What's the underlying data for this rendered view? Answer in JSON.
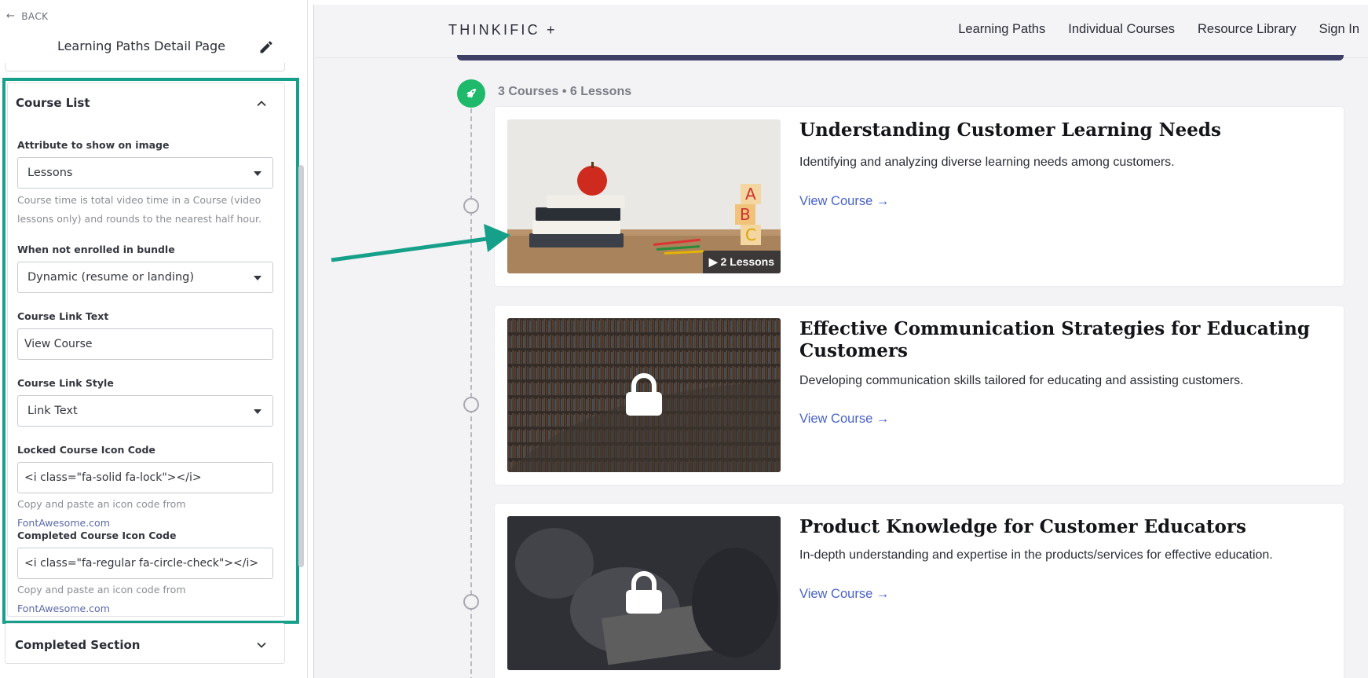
{
  "editor": {
    "back_label": "BACK",
    "page_title": "Learning Paths Detail Page",
    "course_list": {
      "title": "Course List",
      "attribute_label": "Attribute to show on image",
      "attribute_value": "Lessons",
      "attribute_help": "Course time is total video time in a Course (video lessons only) and rounds to the nearest half hour.",
      "not_enrolled_label": "When not enrolled in bundle",
      "not_enrolled_value": "Dynamic (resume or landing)",
      "link_text_label": "Course Link Text",
      "link_text_value": "View Course",
      "link_style_label": "Course Link Style",
      "link_style_value": "Link Text",
      "locked_icon_label": "Locked Course Icon Code",
      "locked_icon_value": "<i class=\"fa-solid fa-lock\"></i>",
      "locked_help_prefix": "Copy and paste an icon code from ",
      "locked_help_link": "FontAwesome.com",
      "completed_icon_label": "Completed Course Icon Code",
      "completed_icon_value": "<i class=\"fa-regular fa-circle-check\"></i>",
      "completed_help_prefix": "Copy and paste an icon code from ",
      "completed_help_link": "FontAwesome.com"
    },
    "completed_section": {
      "title": "Completed Section"
    }
  },
  "preview": {
    "logo": "THINKIFIC +",
    "nav": [
      "Learning Paths",
      "Individual Courses",
      "Resource Library",
      "Sign In"
    ],
    "summary": "3 Courses • 6 Lessons",
    "courses": [
      {
        "title": "Understanding Customer Learning Needs",
        "description": "Identifying and analyzing diverse learning needs among customers.",
        "link": "View Course →",
        "badge": "2 Lessons",
        "locked": false
      },
      {
        "title": "Effective Communication Strategies for Educating Customers",
        "description": "Developing communication skills tailored for educating and assisting customers.",
        "link": "View Course →",
        "locked": true
      },
      {
        "title": "Product Knowledge for Customer Educators",
        "description": "In-depth understanding and expertise in the products/services for effective education.",
        "link": "View Course →",
        "locked": true
      }
    ]
  },
  "colors": {
    "highlight": "#16a08a",
    "link": "#4a63c7",
    "rocket": "#1fb96b",
    "banner": "#3d3f66"
  }
}
